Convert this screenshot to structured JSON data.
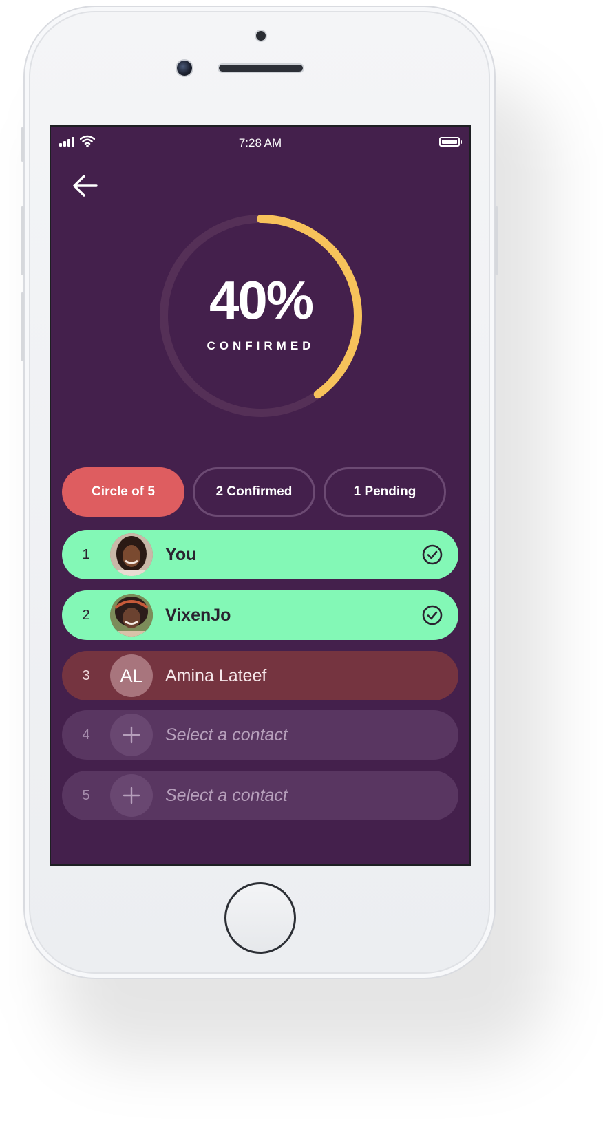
{
  "status_bar": {
    "time": "7:28 AM"
  },
  "progress": {
    "percent_text": "40%",
    "label": "CONFIRMED",
    "fraction": 0.4,
    "accent_color": "#f7c25b",
    "track_color": "#553057"
  },
  "filters": [
    {
      "label": "Circle of 5",
      "active": true
    },
    {
      "label": "2 Confirmed",
      "active": false
    },
    {
      "label": "1 Pending",
      "active": false
    }
  ],
  "members": [
    {
      "number": "1",
      "name": "You",
      "status": "confirmed"
    },
    {
      "number": "2",
      "name": "VixenJo",
      "status": "confirmed"
    },
    {
      "number": "3",
      "name": "Amina Lateef",
      "initials": "AL",
      "status": "pending"
    },
    {
      "number": "4",
      "name": "Select a contact",
      "status": "empty"
    },
    {
      "number": "5",
      "name": "Select a contact",
      "status": "empty"
    }
  ],
  "colors": {
    "background": "#44204c",
    "confirmed": "#83f8b6",
    "pending": "#753440",
    "empty": "#593661",
    "active_pill": "#de5d60"
  }
}
